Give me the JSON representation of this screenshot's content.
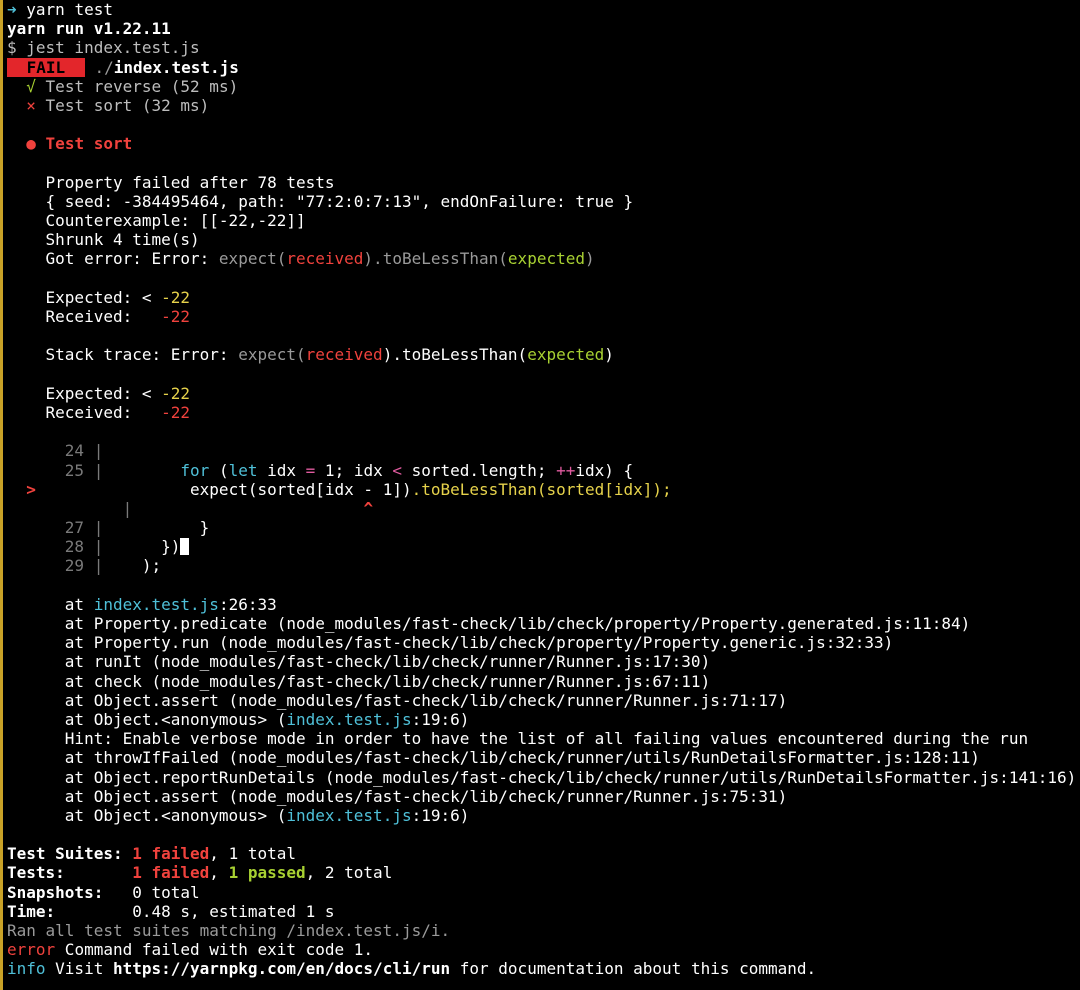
{
  "prompt": {
    "arrow": "➜",
    "command": "yarn test"
  },
  "yarn": {
    "version_line": "yarn run v1.22.11",
    "jest_cmd": "$ jest index.test.js"
  },
  "suite": {
    "badge": " FAIL ",
    "file": "./index.test.js"
  },
  "tests": [
    {
      "mark": "√",
      "name": "Test reverse (52 ms)"
    },
    {
      "mark": "×",
      "name": "Test sort (32 ms)"
    }
  ],
  "failure": {
    "bullet": "●",
    "title": "Test sort",
    "prop_failed": "Property failed after 78 tests",
    "seed": "{ seed: -384495464, path: \"77:2:0:7:13\", endOnFailure: true }",
    "counterexample": "Counterexample: [[-22,-22]]",
    "shrunk": "Shrunk 4 time(s)",
    "got_error": {
      "prefix": "Got error: Error: ",
      "expect": "expect(",
      "received": "received",
      "mid": ").toBeLessThan(",
      "expected": "expected",
      "close": ")"
    },
    "expected_label": "Expected: < ",
    "expected_val": "-22",
    "received_label": "Received:   ",
    "received_val": "-22",
    "stack_trace": {
      "prefix": "Stack trace: Error: ",
      "expect": "expect(",
      "received": "received",
      "mid": ").toBeLessThan(",
      "expected": "expected",
      "close": ")"
    },
    "expected_label2": "Expected: < ",
    "expected_val2": "-22",
    "received_label2": "Received:   ",
    "received_val2": "-22"
  },
  "code": {
    "l24": {
      "num": "24"
    },
    "l25": {
      "num": "25",
      "kw_for": "for",
      "p1": " (",
      "kw_let": "let",
      "p2": " idx ",
      "op_eq": "=",
      "p3": " 1; idx ",
      "op_lt": "<",
      "p4": " sorted.length; ",
      "op_inc": "++",
      "p5": "idx) {"
    },
    "l26": {
      "marker": ">",
      "pre": "expect(sorted[idx - 1])",
      "matcher": ".toBeLessThan(sorted[idx]);"
    },
    "caret": "^",
    "l27": {
      "num": "27",
      "text": "}"
    },
    "l28": {
      "num": "28",
      "text": "})"
    },
    "l29": {
      "num": "29",
      "text": ");"
    }
  },
  "stack": {
    "s1_pre": "at ",
    "s1_loc": "index.test.js",
    "s1_rest": ":26:33",
    "s2": "at Property.predicate (node_modules/fast-check/lib/check/property/Property.generated.js:11:84)",
    "s3": "at Property.run (node_modules/fast-check/lib/check/property/Property.generic.js:32:33)",
    "s4": "at runIt (node_modules/fast-check/lib/check/runner/Runner.js:17:30)",
    "s5": "at check (node_modules/fast-check/lib/check/runner/Runner.js:67:11)",
    "s6": "at Object.assert (node_modules/fast-check/lib/check/runner/Runner.js:71:17)",
    "s7_pre": "at Object.<anonymous> (",
    "s7_loc": "index.test.js",
    "s7_rest": ":19:6)",
    "hint": "Hint: Enable verbose mode in order to have the list of all failing values encountered during the run",
    "s8": "at throwIfFailed (node_modules/fast-check/lib/check/runner/utils/RunDetailsFormatter.js:128:11)",
    "s9": "at Object.reportRunDetails (node_modules/fast-check/lib/check/runner/utils/RunDetailsFormatter.js:141:16)",
    "s10": "at Object.assert (node_modules/fast-check/lib/check/runner/Runner.js:75:31)",
    "s11_pre": "at Object.<anonymous> (",
    "s11_loc": "index.test.js",
    "s11_rest": ":19:6)"
  },
  "summary": {
    "suites_label": "Test Suites: ",
    "suites_failed": "1 failed",
    "suites_rest": ", 1 total",
    "tests_label": "Tests:       ",
    "tests_failed": "1 failed",
    "tests_sep": ", ",
    "tests_passed": "1 passed",
    "tests_rest": ", 2 total",
    "snap_label": "Snapshots:   ",
    "snap_val": "0 total",
    "time_label": "Time:        ",
    "time_val": "0.48 s, estimated 1 s",
    "ran": "Ran all test suites matching /index.test.js/i."
  },
  "footer": {
    "error_tag": "error",
    "error_msg": " Command failed with exit code 1.",
    "info_tag": "info",
    "info_pre": " Visit ",
    "info_url": "https://yarnpkg.com/en/docs/cli/run",
    "info_post": " for documentation about this command."
  },
  "colors": {
    "fail_red": "#e3262b",
    "pass_green": "#a8d132",
    "expected_yellow": "#e6d24b",
    "link_cyan": "#4fc0d8"
  }
}
